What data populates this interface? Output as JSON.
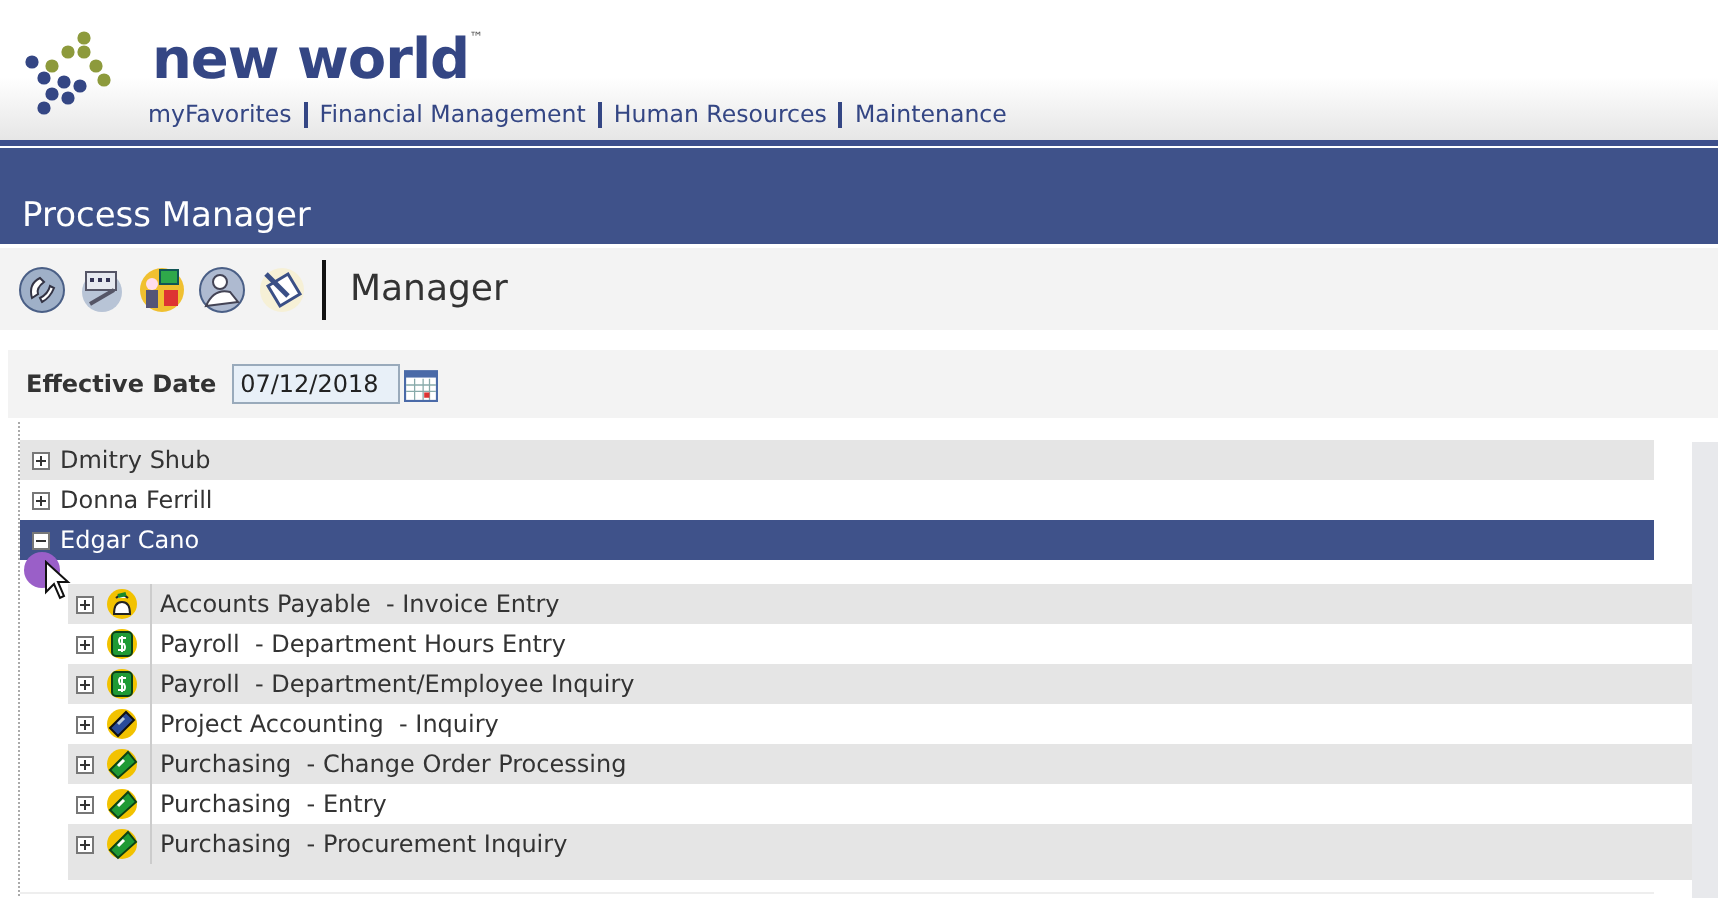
{
  "header": {
    "brand": "new world",
    "trademark": "™",
    "nav": [
      "myFavorites",
      "Financial Management",
      "Human Resources",
      "Maintenance"
    ]
  },
  "title_bar": {
    "title": "Process Manager"
  },
  "toolbar": {
    "label": "Manager"
  },
  "filter": {
    "label": "Effective Date",
    "value": "07/12/2018"
  },
  "tree": {
    "nodes": [
      {
        "name": "Dmitry Shub",
        "expanded": false,
        "selected": false
      },
      {
        "name": "Donna Ferrill",
        "expanded": false,
        "selected": false
      },
      {
        "name": "Edgar Cano",
        "expanded": true,
        "selected": true,
        "children": [
          {
            "label": "Accounts Payable  - Invoice Entry",
            "kind": "payable",
            "expanded": false
          },
          {
            "label": "Payroll  - Department Hours Entry",
            "kind": "payroll",
            "expanded": false
          },
          {
            "label": "Payroll  - Department/Employee Inquiry",
            "kind": "payroll",
            "expanded": false
          },
          {
            "label": "Project Accounting  - Inquiry",
            "kind": "project",
            "expanded": false
          },
          {
            "label": "Purchasing  - Change Order Processing",
            "kind": "purchasing",
            "expanded": false
          },
          {
            "label": "Purchasing  - Entry",
            "kind": "purchasing",
            "expanded": false
          },
          {
            "label": "Purchasing  - Procurement Inquiry",
            "kind": "purchasing",
            "expanded": false
          }
        ]
      }
    ]
  }
}
